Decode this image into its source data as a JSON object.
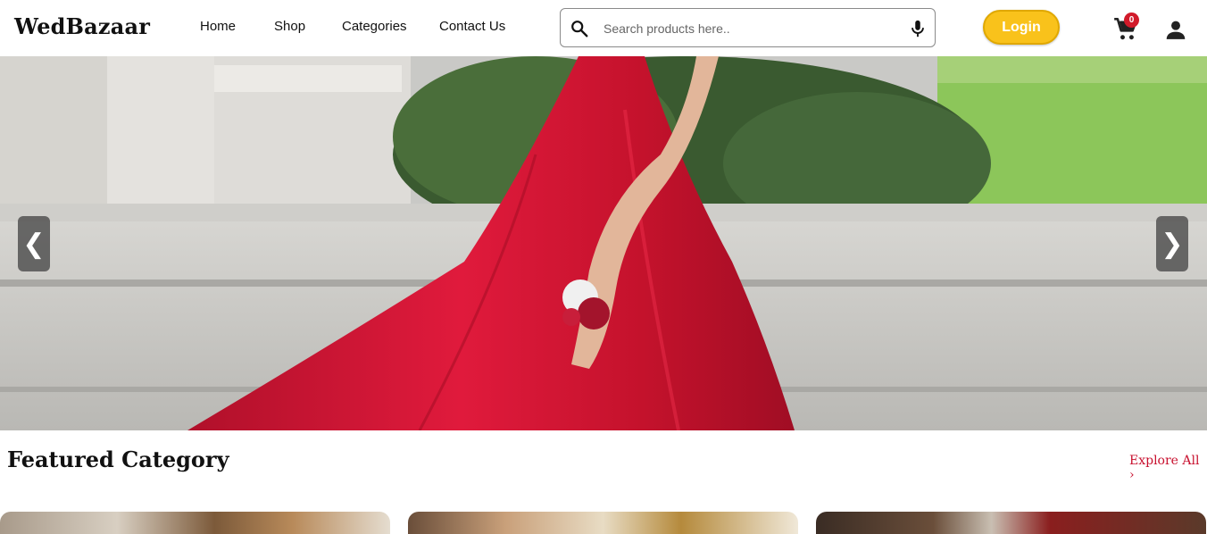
{
  "header": {
    "logo": "WedBazaar",
    "nav": [
      {
        "label": "Home"
      },
      {
        "label": "Shop"
      },
      {
        "label": "Categories"
      },
      {
        "label": "Contact Us"
      }
    ],
    "search_placeholder": "Search products here..",
    "login_label": "Login",
    "cart_count": "0"
  },
  "hero": {
    "prev_label": "❮",
    "next_label": "❯"
  },
  "featured": {
    "title": "Featured Category",
    "explore_label": "Explore All ›"
  },
  "colors": {
    "accent": "#f9c21b",
    "badge": "#d11a2a",
    "link": "#c8102e"
  }
}
